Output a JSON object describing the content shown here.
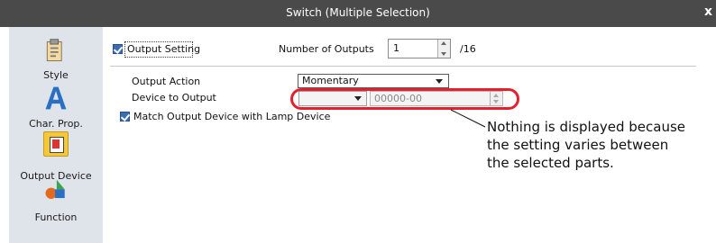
{
  "window": {
    "title": "Switch (Multiple Selection)",
    "close_glyph": "x"
  },
  "sidebar": {
    "items": [
      {
        "label": "Style",
        "icon": "style-icon"
      },
      {
        "label": "Char. Prop.",
        "icon": "letter-a-icon"
      },
      {
        "label": "Output Device",
        "icon": "output-device-icon",
        "active": true
      },
      {
        "label": "Function",
        "icon": "function-icon"
      }
    ]
  },
  "output_setting": {
    "label": "Output Setting",
    "checked": true,
    "num_outputs_label": "Number of Outputs",
    "num_outputs_value": "1",
    "max_suffix": "/16"
  },
  "output_action": {
    "label": "Output Action",
    "value": "Momentary"
  },
  "device": {
    "label": "Device to Output",
    "type_value": "",
    "address_value": "00000-00"
  },
  "match_lamp": {
    "label": "Match Output Device with Lamp Device",
    "checked": true
  },
  "annotation": {
    "line1": "Nothing is displayed because",
    "line2": "the setting varies between",
    "line3": "the selected parts.",
    "color": "#e4202c"
  },
  "colors": {
    "titlebar": "#4a4a4a",
    "sidebar": "#dfe4ea",
    "accent": "#3b6db2"
  }
}
